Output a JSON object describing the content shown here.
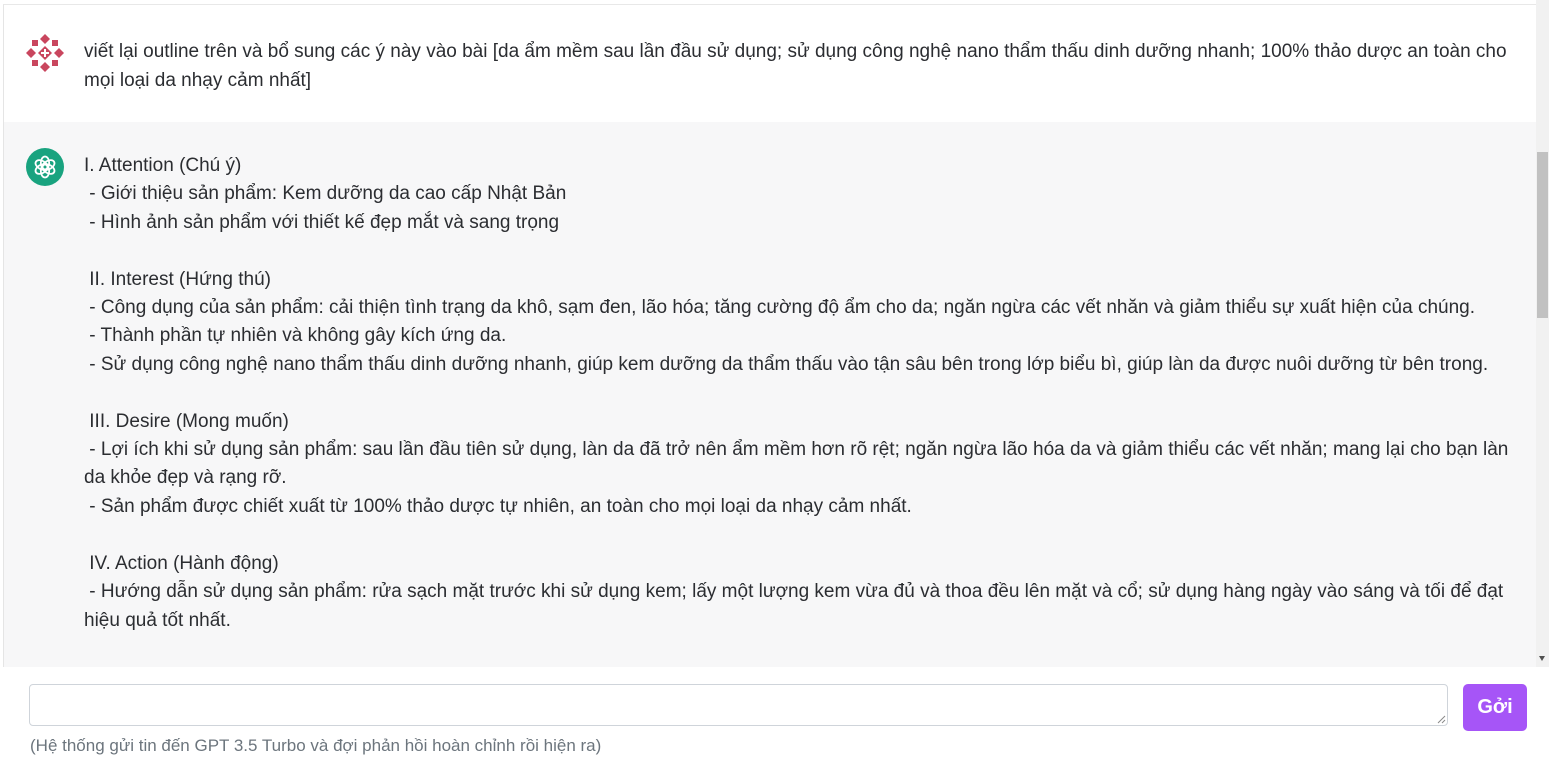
{
  "conversation": {
    "user_message": "viết lại outline trên và bổ sung các ý này vào bài [da ẩm mềm sau lần đầu sử dụng; sử dụng công nghệ nano thẩm thấu dinh dưỡng nhanh; 100% thảo dược an toàn cho mọi loại da nhạy cảm nhất]",
    "bot_message": "I. Attention (Chú ý)\n - Giới thiệu sản phẩm: Kem dưỡng da cao cấp Nhật Bản\n - Hình ảnh sản phẩm với thiết kế đẹp mắt và sang trọng\n\n II. Interest (Hứng thú)\n - Công dụng của sản phẩm: cải thiện tình trạng da khô, sạm đen, lão hóa; tăng cường độ ẩm cho da; ngăn ngừa các vết nhăn và giảm thiểu sự xuất hiện của chúng.\n - Thành phần tự nhiên và không gây kích ứng da.\n - Sử dụng công nghệ nano thẩm thấu dinh dưỡng nhanh, giúp kem dưỡng da thẩm thấu vào tận sâu bên trong lớp biểu bì, giúp làn da được nuôi dưỡng từ bên trong.\n\n III. Desire (Mong muốn)\n - Lợi ích khi sử dụng sản phẩm: sau lần đầu tiên sử dụng, làn da đã trở nên ẩm mềm hơn rõ rệt; ngăn ngừa lão hóa da và giảm thiểu các vết nhăn; mang lại cho bạn làn da khỏe đẹp và rạng rỡ.\n - Sản phẩm được chiết xuất từ 100% thảo dược tự nhiên, an toàn cho mọi loại da nhạy cảm nhất.\n\n IV. Action (Hành động)\n - Hướng dẫn sử dụng sản phẩm: rửa sạch mặt trước khi sử dụng kem; lấy một lượng kem vừa đủ và thoa đều lên mặt và cổ; sử dụng hàng ngày vào sáng và tối để đạt hiệu quả tốt nhất."
  },
  "composer": {
    "input_value": "",
    "send_label": "Gởi",
    "hint": "(Hệ thống gửi tin đến GPT 3.5 Turbo và đợi phản hồi hoàn chỉnh rồi hiện ra)"
  },
  "icons": {
    "user_avatar": "geometric-pattern-avatar-icon",
    "bot_avatar": "openai-logo-icon",
    "resize": "resize-grip-icon"
  },
  "colors": {
    "send_button": "#a655f7",
    "bot_avatar_bg": "#19a37f",
    "user_avatar": "#c9465e",
    "bot_message_bg": "#f7f7f8"
  }
}
